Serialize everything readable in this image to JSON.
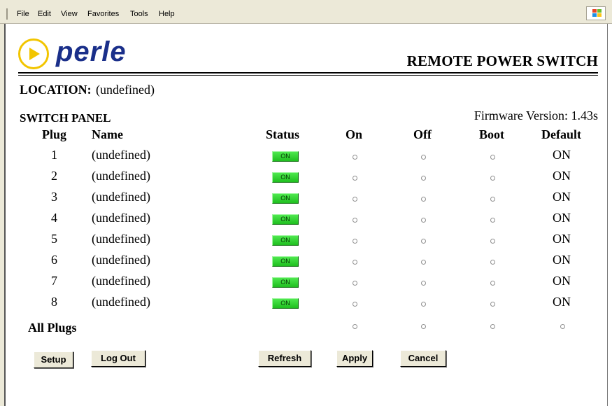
{
  "menu": {
    "items": [
      "File",
      "Edit",
      "View",
      "Favorites",
      "Tools",
      "Help"
    ],
    "logo_icon": "windows-flag-icon"
  },
  "brand": {
    "logo_text": "perle",
    "logo_color": "#1a2f8a",
    "logo_accent": "#f2c500",
    "page_title": "REMOTE POWER SWITCH"
  },
  "location": {
    "label": "LOCATION:",
    "value": "(undefined)"
  },
  "panel": {
    "title": "SWITCH PANEL",
    "firmware": "Firmware Version: 1.43s",
    "headers": {
      "plug": "Plug",
      "name": "Name",
      "status": "Status",
      "on": "On",
      "off": "Off",
      "boot": "Boot",
      "default": "Default"
    },
    "rows": [
      {
        "plug": "1",
        "name": "(undefined)",
        "status": "ON",
        "default": "ON"
      },
      {
        "plug": "2",
        "name": "(undefined)",
        "status": "ON",
        "default": "ON"
      },
      {
        "plug": "3",
        "name": "(undefined)",
        "status": "ON",
        "default": "ON"
      },
      {
        "plug": "4",
        "name": "(undefined)",
        "status": "ON",
        "default": "ON"
      },
      {
        "plug": "5",
        "name": "(undefined)",
        "status": "ON",
        "default": "ON"
      },
      {
        "plug": "6",
        "name": "(undefined)",
        "status": "ON",
        "default": "ON"
      },
      {
        "plug": "7",
        "name": "(undefined)",
        "status": "ON",
        "default": "ON"
      },
      {
        "plug": "8",
        "name": "(undefined)",
        "status": "ON",
        "default": "ON"
      }
    ],
    "all_plugs_label": "All Plugs",
    "status_color": "#2fd62f"
  },
  "buttons": {
    "setup": "Setup",
    "logout": "Log Out",
    "refresh": "Refresh",
    "apply": "Apply",
    "cancel": "Cancel"
  }
}
